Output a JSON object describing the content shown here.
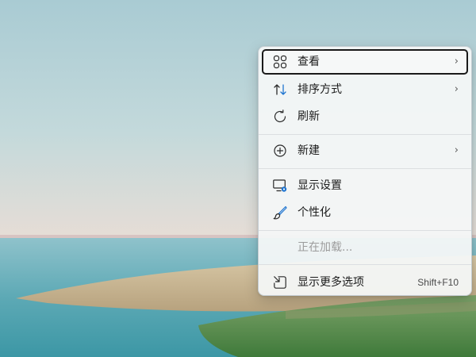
{
  "context_menu": {
    "items": [
      {
        "label": "查看",
        "icon": "view-grid-icon",
        "submenu": true
      },
      {
        "label": "排序方式",
        "icon": "sort-arrows-icon",
        "submenu": true
      },
      {
        "label": "刷新",
        "icon": "refresh-icon",
        "submenu": false
      },
      {
        "label": "新建",
        "icon": "new-plus-icon",
        "submenu": true
      },
      {
        "label": "显示设置",
        "icon": "display-settings-icon",
        "submenu": false
      },
      {
        "label": "个性化",
        "icon": "brush-icon",
        "submenu": false
      },
      {
        "label": "正在加载...",
        "icon": "",
        "submenu": false,
        "disabled": true
      },
      {
        "label": "显示更多选项",
        "icon": "show-more-options-icon",
        "shortcut": "Shift+F10",
        "submenu": false
      }
    ],
    "focused_item": "查看",
    "chevron_glyph": "›"
  },
  "colors": {
    "accent_blue": "#1e74d0",
    "menu_background": "#f4f7f7",
    "focus_border": "#1a1a1a",
    "disabled_text": "#9c9c9c"
  }
}
